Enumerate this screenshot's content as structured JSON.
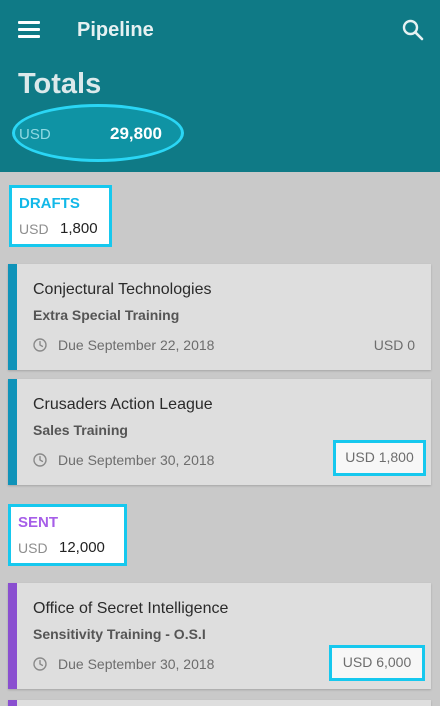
{
  "header": {
    "title": "Pipeline",
    "menu_icon": "hamburger-menu-icon",
    "search_icon": "search-icon",
    "bar_color": "#0f7a86"
  },
  "totals": {
    "title": "Totals",
    "currency": "USD",
    "amount": "29,800"
  },
  "sections": [
    {
      "label": "DRAFTS",
      "color": "#12b8e8",
      "currency": "USD",
      "amount": "1,800",
      "cards": [
        {
          "client": "Conjectural Technologies",
          "project": "Extra Special Training",
          "due": "Due September 22, 2018",
          "amount": "USD 0"
        },
        {
          "client": "Crusaders Action League",
          "project": "Sales Training",
          "due": "Due September 30, 2018",
          "amount": "USD 1,800"
        }
      ]
    },
    {
      "label": "SENT",
      "color": "#a65ee8",
      "currency": "USD",
      "amount": "12,000",
      "cards": [
        {
          "client": "Office of Secret Intelligence",
          "project": "Sensitivity Training - O.S.I",
          "due": "Due September 30, 2018",
          "amount": "USD 6,000"
        }
      ]
    }
  ]
}
